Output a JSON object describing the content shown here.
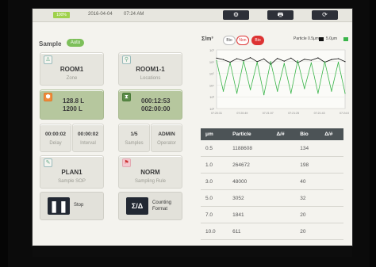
{
  "status": {
    "battery": "100%",
    "date": "2016-04-04",
    "time": "07:24 AM",
    "buttons": [
      "⚙",
      "🖶",
      "⟳"
    ]
  },
  "left": {
    "title": "Sample",
    "mode_badge": "Auto",
    "zone": {
      "value": "ROOM1",
      "label": "Zone"
    },
    "location": {
      "value": "ROOM1-1",
      "label": "Locations"
    },
    "volume": {
      "line1": "128.8 L",
      "line2": "1200 L"
    },
    "timer": {
      "line1": "000:12:53",
      "line2": "002:00:00"
    },
    "delay": {
      "value": "00:00:02",
      "label": "Delay"
    },
    "interval": {
      "value": "00:00:02",
      "label": "Interval"
    },
    "samples": {
      "value": "1/5",
      "label": "Samples"
    },
    "operator": {
      "value": "ADMIN",
      "label": "Operator"
    },
    "sop": {
      "value": "PLAN1",
      "label": "Sample SOP"
    },
    "rule": {
      "value": "NORM",
      "label": "Sampling Rule"
    },
    "stop_button": "Stop",
    "counting_button": {
      "symbol": "Σ/Δ",
      "line1": "Counting",
      "line2": "Format"
    }
  },
  "right": {
    "chart_title": "Σ/m³",
    "bio_labels": [
      "Bio",
      "Non",
      "Bio"
    ],
    "legend": [
      {
        "name": "Particle 0.5μm",
        "color": "#111111"
      },
      {
        "name": "5.0μm",
        "color": "#3ab54a"
      }
    ],
    "table": {
      "headers": [
        "μm",
        "Particle",
        "Δ/#",
        "Bio",
        "Δ/#"
      ],
      "rows": [
        [
          "0.5",
          "1188608",
          "",
          "134",
          ""
        ],
        [
          "1.0",
          "264672",
          "",
          "198",
          ""
        ],
        [
          "3.0",
          "48000",
          "",
          "40",
          ""
        ],
        [
          "5.0",
          "3052",
          "",
          "32",
          ""
        ],
        [
          "7.0",
          "1841",
          "",
          "20",
          ""
        ],
        [
          "10.0",
          "611",
          "",
          "20",
          ""
        ]
      ]
    }
  },
  "chart_data": {
    "type": "line",
    "title": "",
    "ylabel": "Σ/m³",
    "y_scale": "log",
    "y_tick_labels": [
      "10⁷",
      "10⁶",
      "10⁵",
      "10⁴",
      "10³",
      "10²"
    ],
    "x_tick_labels": [
      "07:20:31",
      "07:20:49",
      "07:21:07",
      "07:21:25",
      "07:21:43",
      "07:24:01"
    ],
    "series": [
      {
        "name": "Particle 0.5μm",
        "color": "#111111",
        "values": [
          2000000.0,
          1500000.0,
          900000.0,
          1800000.0,
          1200000.0,
          2200000.0,
          1000000.0,
          1700000.0,
          600000.0,
          1900000.0,
          1100000.0,
          2000000.0,
          800000.0,
          1600000.0,
          1300000.0,
          2100000.0,
          900000.0,
          1500000.0,
          1800000.0,
          1000000.0
        ]
      },
      {
        "name": "5.0μm",
        "color": "#3ab54a",
        "values": [
          1200000.0,
          3000.0,
          800000.0,
          2000.0,
          1100000.0,
          4000.0,
          900000.0,
          1500.0,
          1000000.0,
          3000.0,
          700000.0,
          2000.0,
          1200000.0,
          5000.0,
          800000.0,
          2000.0,
          1000000.0,
          3000.0,
          900000.0,
          2000.0
        ]
      }
    ]
  }
}
